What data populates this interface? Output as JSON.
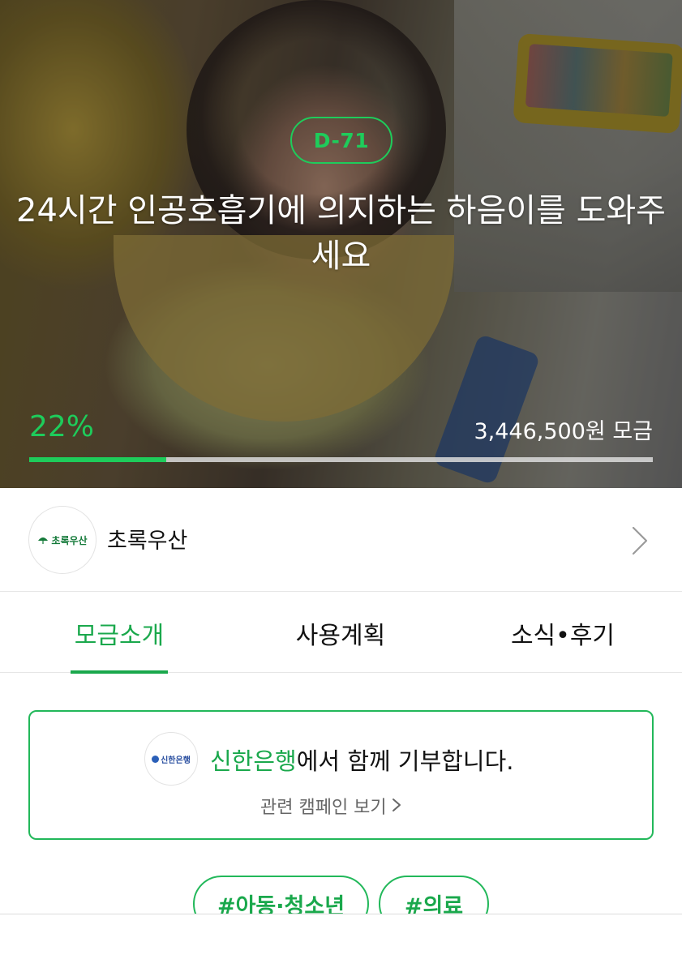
{
  "hero": {
    "dday": "D-71",
    "title": "24시간 인공호흡기에 의지하는 하음이를 도와주세요",
    "progress_percent_label": "22%",
    "progress_fraction": 0.22,
    "raised_amount": "3,446,500원 모금"
  },
  "organization": {
    "logo_text": "초록우산",
    "name": "초록우산"
  },
  "tabs": [
    {
      "label": "모금소개",
      "active": true
    },
    {
      "label": "사용계획",
      "active": false
    },
    {
      "label": "소식•후기",
      "active": false
    }
  ],
  "partner": {
    "logo_text": "신한은행",
    "bank": "신한은행",
    "suffix": "에서 함께 기부합니다.",
    "related_link": "관련 캠페인 보기"
  },
  "tags": [
    "#아동·청소년",
    "#의료"
  ],
  "colors": {
    "accent": "#1aa84c",
    "accent_bright": "#1ecc5b"
  }
}
